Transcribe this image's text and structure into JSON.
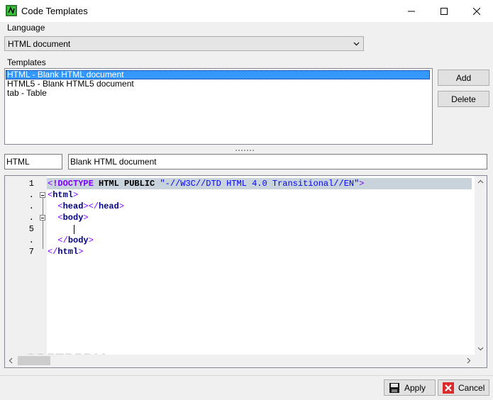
{
  "window": {
    "title": "Code Templates",
    "icon": "code-templates-app-icon"
  },
  "language": {
    "label": "Language",
    "selected": "HTML document"
  },
  "templates": {
    "label": "Templates",
    "items": [
      {
        "text": "HTML  -  Blank HTML document",
        "selected": true
      },
      {
        "text": "HTML5  -  Blank HTML5 document",
        "selected": false
      },
      {
        "text": "tab  -  Table",
        "selected": false
      }
    ],
    "add_label": "Add",
    "delete_label": "Delete"
  },
  "template_fields": {
    "name": "HTML",
    "description": "Blank HTML document"
  },
  "editor": {
    "line_numbers": [
      "1",
      ".",
      ".",
      ".",
      "5",
      ".",
      "7"
    ],
    "code": {
      "line1": {
        "open": "<",
        "doctype": "!DOCTYPE",
        "html_kw": " HTML",
        "public_kw": " PUBLIC",
        "string": " \"-//W3C//DTD HTML 4.0 Transitional//EN\"",
        "close": ">"
      },
      "line2": {
        "open": "<",
        "tag": "html",
        "close": ">"
      },
      "line3": {
        "indent": "  ",
        "open": "<",
        "tag": "head",
        "mid": "></",
        "tag2": "head",
        "close": ">"
      },
      "line4": {
        "indent": "  ",
        "open": "<",
        "tag": "body",
        "close": ">"
      },
      "line6": {
        "indent": "  ",
        "open": "</",
        "tag": "body",
        "close": ">"
      },
      "line7": {
        "open": "</",
        "tag": "html",
        "close": ">"
      }
    },
    "watermark": "SOFTPEDIA"
  },
  "footer": {
    "apply_label": "Apply",
    "cancel_label": "Cancel"
  },
  "colors": {
    "selection": "#3399ff",
    "tag": "#000080",
    "bracket": "#8000ff",
    "string": "#0000ff",
    "current_line": "#c8d3dc"
  }
}
